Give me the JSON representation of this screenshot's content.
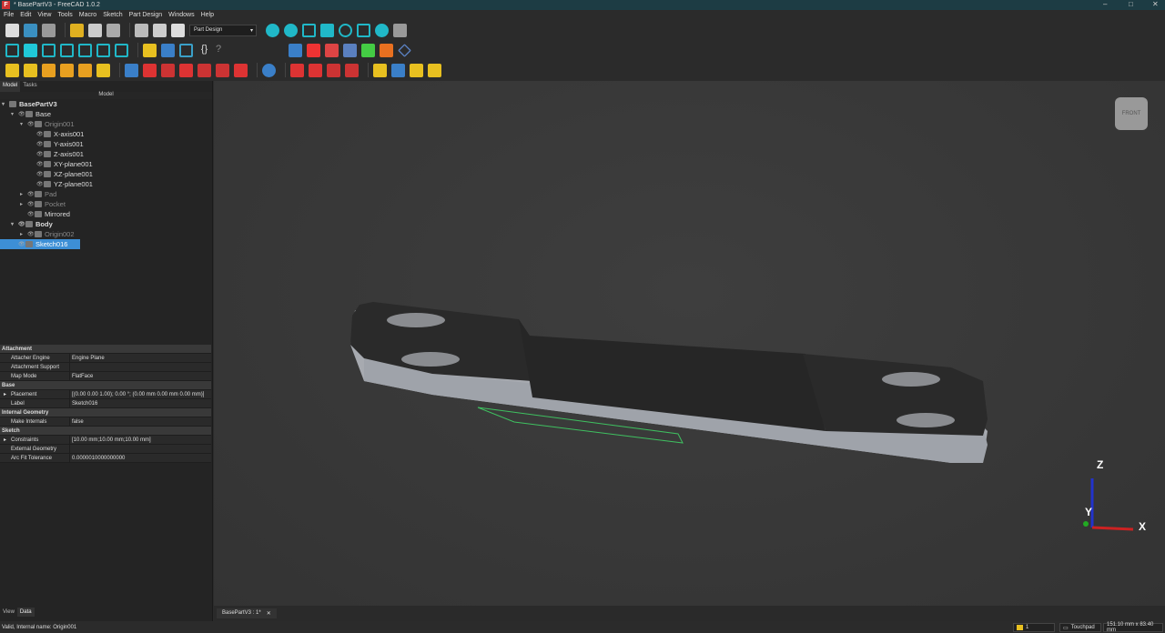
{
  "title": "* BasePartV3 - FreeCAD 1.0.2",
  "menu": [
    "File",
    "Edit",
    "View",
    "Tools",
    "Macro",
    "Sketch",
    "Part Design",
    "Windows",
    "Help"
  ],
  "workbench": "Part Design",
  "panel_tabs": [
    "Model",
    "Tasks"
  ],
  "tree_header": "Model",
  "tree": [
    {
      "label": "BasePartV3",
      "level": 0,
      "arrow": "▾",
      "eye": false,
      "style": "bold"
    },
    {
      "label": "Base",
      "level": 1,
      "arrow": "▾",
      "eye": true,
      "style": ""
    },
    {
      "label": "Origin001",
      "level": 2,
      "arrow": "▾",
      "eye": true,
      "style": "dim"
    },
    {
      "label": "X-axis001",
      "level": 3,
      "arrow": "",
      "eye": true,
      "style": ""
    },
    {
      "label": "Y-axis001",
      "level": 3,
      "arrow": "",
      "eye": true,
      "style": ""
    },
    {
      "label": "Z-axis001",
      "level": 3,
      "arrow": "",
      "eye": true,
      "style": ""
    },
    {
      "label": "XY-plane001",
      "level": 3,
      "arrow": "",
      "eye": true,
      "style": ""
    },
    {
      "label": "XZ-plane001",
      "level": 3,
      "arrow": "",
      "eye": true,
      "style": ""
    },
    {
      "label": "YZ-plane001",
      "level": 3,
      "arrow": "",
      "eye": true,
      "style": ""
    },
    {
      "label": "Pad",
      "level": 2,
      "arrow": "▸",
      "eye": true,
      "style": "dim"
    },
    {
      "label": "Pocket",
      "level": 2,
      "arrow": "▸",
      "eye": true,
      "style": "dim"
    },
    {
      "label": "Mirrored",
      "level": 2,
      "arrow": "",
      "eye": true,
      "style": ""
    },
    {
      "label": "Body",
      "level": 1,
      "arrow": "▾",
      "eye": true,
      "style": "bold"
    },
    {
      "label": "Origin002",
      "level": 2,
      "arrow": "▸",
      "eye": true,
      "style": "dim"
    },
    {
      "label": "Sketch016",
      "level": 1,
      "arrow": "",
      "eye": true,
      "style": "sel"
    }
  ],
  "properties": [
    {
      "group": "Attachment"
    },
    {
      "key": "Attacher Engine",
      "value": "Engine Plane"
    },
    {
      "key": "Attachment Support",
      "value": ""
    },
    {
      "key": "Map Mode",
      "value": "FlatFace"
    },
    {
      "group": "Base"
    },
    {
      "key": "Placement",
      "value": "[(0.00 0.00 1.00); 0.00 °; (0.00 mm  0.00 mm  0.00 mm)]",
      "expand": true
    },
    {
      "key": "Label",
      "value": "Sketch016"
    },
    {
      "group": "Internal Geometry"
    },
    {
      "key": "Make Internals",
      "value": "false"
    },
    {
      "group": "Sketch"
    },
    {
      "key": "Constraints",
      "value": "[10.00 mm;10.00 mm;10.00 mm]",
      "expand": true
    },
    {
      "key": "External Geometry",
      "value": ""
    },
    {
      "key": "Arc Fit Tolerance",
      "value": "0.0000010000000000"
    }
  ],
  "bottom_tabs": [
    "View",
    "Data"
  ],
  "doc_tab": "BasePartV3 : 1*",
  "status": "Valid, Internal name: Origin001",
  "status_right": {
    "layer": "1",
    "nav": "Touchpad",
    "dims": "151.10 mm x 83.40 mm"
  },
  "navcube": "FRONT",
  "axes": {
    "z": "Z",
    "y": "Y",
    "x": "X"
  }
}
